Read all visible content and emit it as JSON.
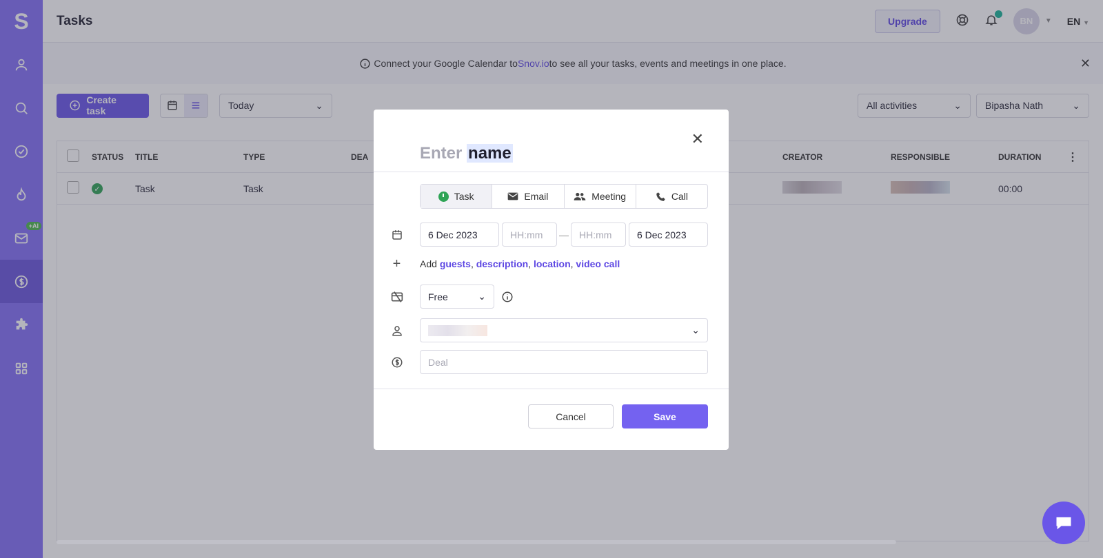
{
  "app": {
    "logo_letter": "S",
    "page_title": "Tasks"
  },
  "sidebar": {
    "items": [
      {
        "name": "prospects",
        "icon": "user-icon"
      },
      {
        "name": "search",
        "icon": "search-icon"
      },
      {
        "name": "tasks",
        "icon": "check-circle-icon"
      },
      {
        "name": "warmup",
        "icon": "flame-icon"
      },
      {
        "name": "campaigns",
        "icon": "mail-icon",
        "badge": "+AI"
      },
      {
        "name": "deals",
        "icon": "dollar-icon"
      },
      {
        "name": "integrations",
        "icon": "puzzle-icon"
      },
      {
        "name": "apps",
        "icon": "grid-icon"
      }
    ]
  },
  "header": {
    "upgrade_label": "Upgrade",
    "avatar_initials": "BN",
    "language": "EN"
  },
  "banner": {
    "text_before": "Connect your Google Calendar to ",
    "link": "Snov.io",
    "text_after": " to see all your tasks, events and meetings in one place."
  },
  "toolbar": {
    "create_label": "Create task",
    "date_filter": "Today",
    "activity_filter": "All activities",
    "user_filter": "Bipasha Nath"
  },
  "table": {
    "headers": {
      "status": "STATUS",
      "title": "TITLE",
      "type": "TYPE",
      "deal": "DEA",
      "creator": "CREATOR",
      "responsible": "RESPONSIBLE",
      "duration": "DURATION"
    },
    "rows": [
      {
        "title": "Task",
        "type": "Task",
        "duration": "00:00"
      }
    ]
  },
  "modal": {
    "name_placeholder_1": "Enter",
    "name_placeholder_2": "name",
    "tabs": [
      {
        "label": "Task",
        "icon": "clock-icon"
      },
      {
        "label": "Email",
        "icon": "envelope-icon"
      },
      {
        "label": "Meeting",
        "icon": "people-icon"
      },
      {
        "label": "Call",
        "icon": "phone-icon"
      }
    ],
    "start_date": "6 Dec 2023",
    "start_time_placeholder": "HH:mm",
    "end_time_placeholder": "HH:mm",
    "end_date": "6 Dec 2023",
    "add_prefix": "Add",
    "add_links": [
      "guests",
      "description",
      "location",
      "video call"
    ],
    "availability": "Free",
    "deal_placeholder": "Deal",
    "cancel_label": "Cancel",
    "save_label": "Save"
  },
  "colors": {
    "accent": "#6a56e8",
    "sidebar": "#8470f5",
    "success": "#2fa456"
  }
}
